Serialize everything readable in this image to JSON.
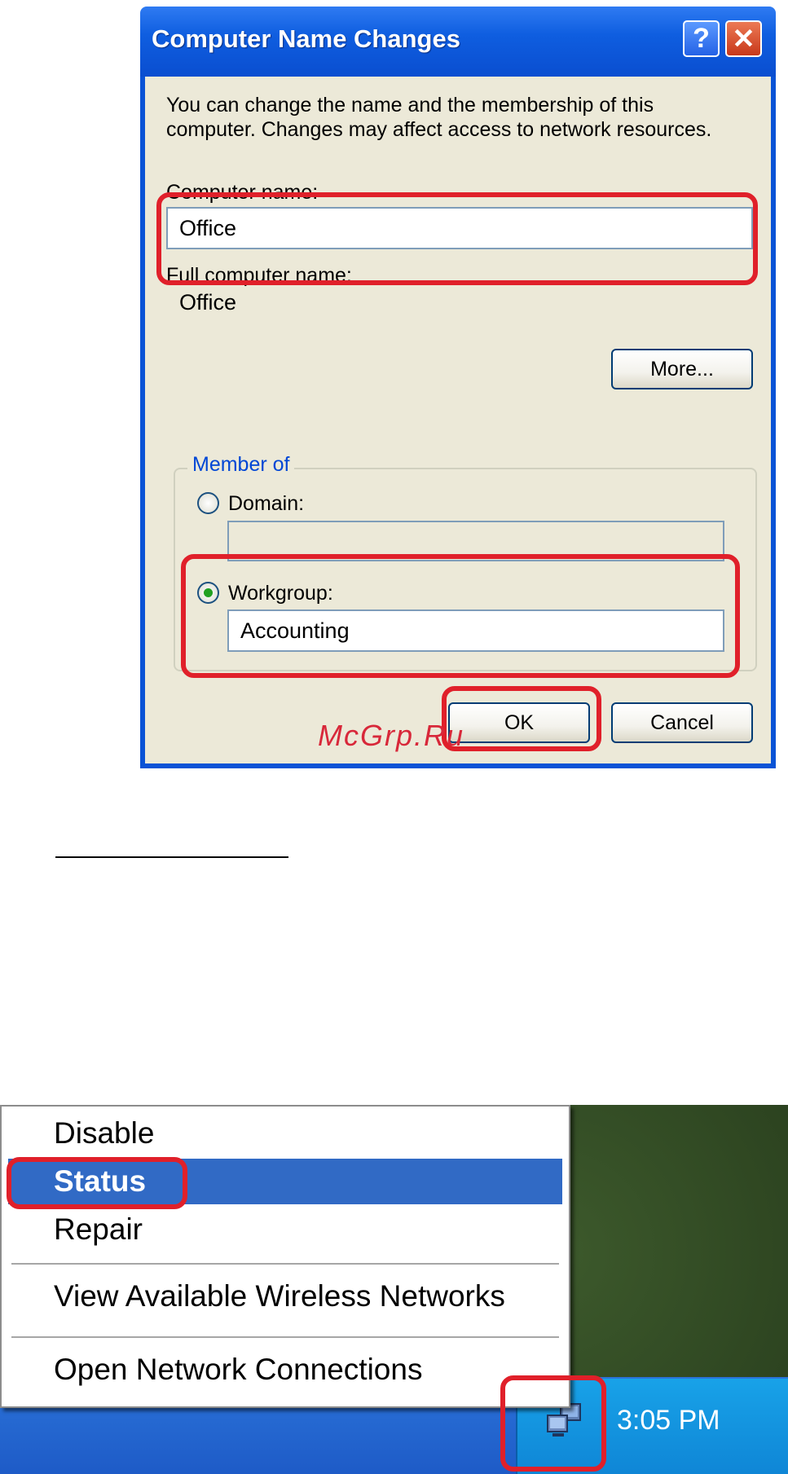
{
  "dialog": {
    "title": "Computer Name Changes",
    "help_button": "?",
    "close_button": "✕",
    "description_line1": "You can change the name and the membership of this",
    "description_line2": "computer. Changes may affect access to network resources.",
    "computer_name_label": "Computer name:",
    "computer_name_value": "Office",
    "full_name_label": "Full computer name:",
    "full_name_value": "Office",
    "more_button": "More...",
    "member_of_legend": "Member of",
    "domain_label": "Domain:",
    "domain_value": "",
    "workgroup_label": "Workgroup:",
    "workgroup_value": "Accounting",
    "ok_button": "OK",
    "cancel_button": "Cancel"
  },
  "watermark": "McGrp.Ru",
  "context_menu": {
    "items": [
      "Disable",
      "Status",
      "Repair",
      "View Available Wireless Networks",
      "Open Network Connections"
    ],
    "selected": "Status"
  },
  "taskbar": {
    "clock": "3:05 PM"
  },
  "colors": {
    "highlight": "#e0202a",
    "selection": "#316ac5",
    "title_blue": "#0a53d6"
  }
}
